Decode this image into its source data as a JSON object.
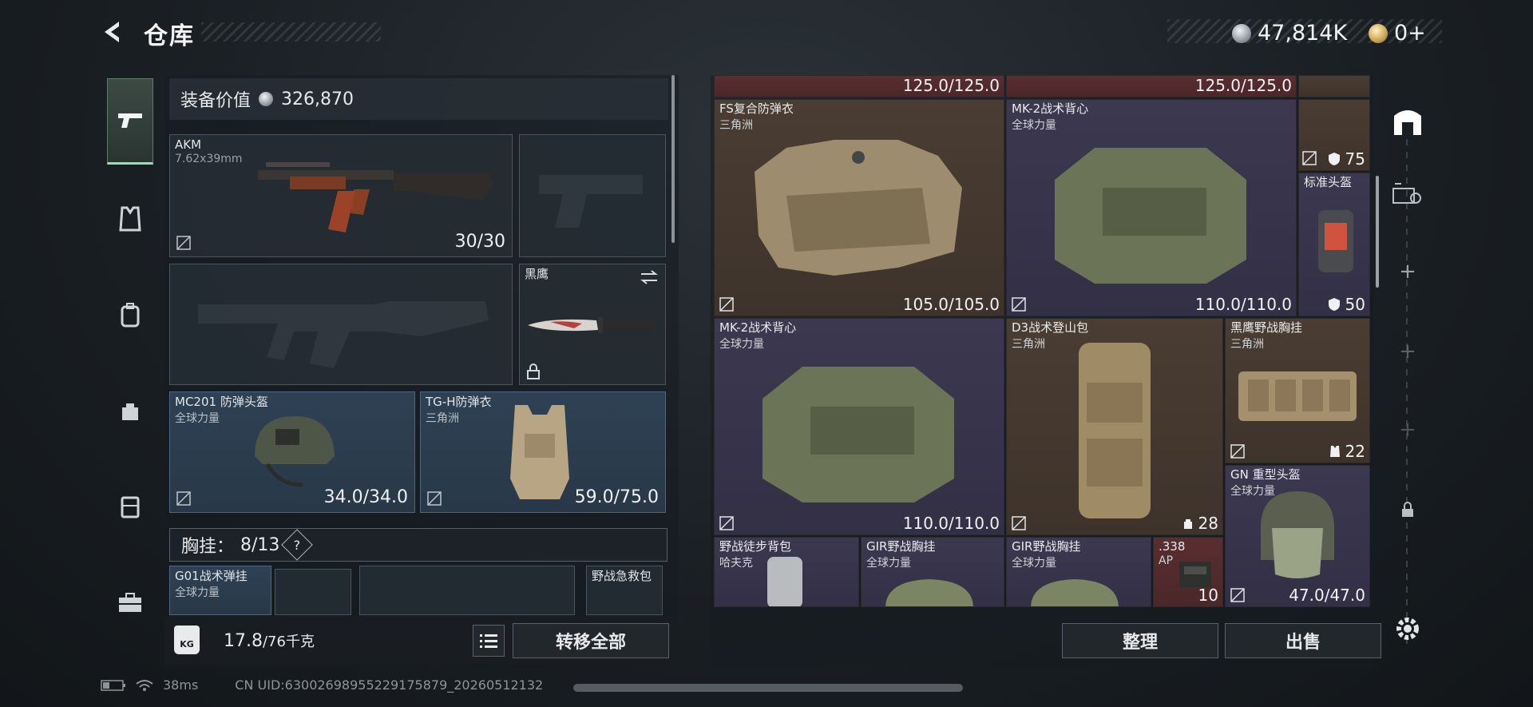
{
  "header": {
    "title": "仓库",
    "currency": [
      {
        "icon": "silver-coin-icon",
        "amount": "47,814K"
      },
      {
        "icon": "gold-coin-icon",
        "amount": "0+"
      }
    ]
  },
  "left_nav": [
    {
      "icon": "pistol-icon",
      "active": true
    },
    {
      "icon": "vest-icon",
      "active": false
    },
    {
      "icon": "backpack-icon",
      "active": false
    },
    {
      "icon": "bag-icon",
      "active": false
    },
    {
      "icon": "case-icon",
      "active": false
    },
    {
      "icon": "toolbox-icon",
      "active": false
    }
  ],
  "loadout": {
    "value_label": "装备价值",
    "value_amount": "326,870",
    "primary_weapon": {
      "name": "AKM",
      "caliber": "7.62x39mm",
      "ammo": "30/30"
    },
    "melee": {
      "name": "黑鹰"
    },
    "helmet": {
      "name": "MC201 防弹头盔",
      "faction": "全球力量",
      "durability": "34.0/34.0"
    },
    "armor": {
      "name": "TG-H防弹衣",
      "faction": "三角洲",
      "durability": "59.0/75.0"
    },
    "chest_rig": {
      "label": "胸挂：",
      "capacity": "8/13",
      "help": "?"
    },
    "rig_slot": {
      "name": "G01战术弹挂",
      "faction": "全球力量"
    },
    "medkit": {
      "name": "野战急救包"
    },
    "weight": {
      "value": "17.8",
      "max": "/76千克",
      "icon_text": "KG"
    },
    "transfer_all": "转移全部"
  },
  "stash": {
    "items": [
      {
        "id": "top-left-partial",
        "value": "125.0/125.0"
      },
      {
        "id": "top-mid-partial",
        "value": "125.0/125.0"
      },
      {
        "id": "fs-armor",
        "name": "FS复合防弹衣",
        "faction": "三角洲",
        "value": "105.0/105.0"
      },
      {
        "id": "mk2-vest-1",
        "name": "MK-2战术背心",
        "faction": "全球力量",
        "value": "110.0/110.0"
      },
      {
        "id": "armor-75",
        "badge": "75"
      },
      {
        "id": "std-helmet",
        "name": "标准头盔",
        "badge": "50"
      },
      {
        "id": "mk2-vest-2",
        "name": "MK-2战术背心",
        "faction": "全球力量",
        "value": "110.0/110.0"
      },
      {
        "id": "d3-pack",
        "name": "D3战术登山包",
        "faction": "三角洲",
        "badge": "28"
      },
      {
        "id": "blackhawk-rig",
        "name": "黑鹰野战胸挂",
        "faction": "三角洲",
        "badge": "22"
      },
      {
        "id": "gn-helmet",
        "name": "GN 重型头盔",
        "faction": "全球力量",
        "value": "47.0/47.0"
      },
      {
        "id": "hiking-pack",
        "name": "野战徒步背包",
        "faction": "哈夫克"
      },
      {
        "id": "gir-rig-1",
        "name": "GIR野战胸挂",
        "faction": "全球力量"
      },
      {
        "id": "gir-rig-2",
        "name": "GIR野战胸挂",
        "faction": "全球力量"
      },
      {
        "id": "ammo-338",
        "name": ".338",
        "sub": "AP",
        "badge": "10"
      }
    ],
    "sort_label": "整理",
    "sell_label": "出售"
  },
  "status": {
    "ping": "38ms",
    "uid": "CN UID:630026989552291758​79_20260512132"
  }
}
